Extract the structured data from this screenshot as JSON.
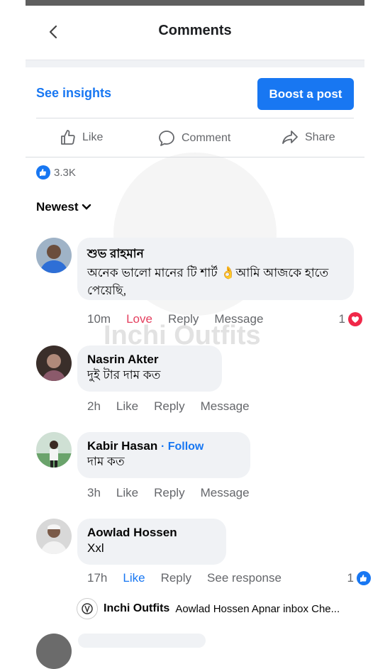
{
  "header": {
    "title": "Comments"
  },
  "post_actions": {
    "see_insights": "See insights",
    "boost": "Boost a post",
    "like": "Like",
    "comment": "Comment",
    "share": "Share"
  },
  "reactions": {
    "count": "3.3K"
  },
  "sort": {
    "label": "Newest"
  },
  "watermark": "Inchi Outfits",
  "comments": [
    {
      "author": "শুভ রাহমান",
      "text": "অনেক ভালো মানের টি শার্ট 👌আমি আজকে হাতে পেয়েছি,",
      "time": "10m",
      "reaction_label": "Love",
      "reply": "Reply",
      "message": "Message",
      "reaction_count": "1"
    },
    {
      "author": "Nasrin Akter",
      "text": "দুই টার দাম কত",
      "time": "2h",
      "like": "Like",
      "reply": "Reply",
      "message": "Message"
    },
    {
      "author": "Kabir Hasan",
      "follow": "Follow",
      "text": "দাম কত",
      "time": "3h",
      "like": "Like",
      "reply": "Reply",
      "message": "Message"
    },
    {
      "author": "Aowlad Hossen",
      "text": "Xxl",
      "time": "17h",
      "like": "Like",
      "reply": "Reply",
      "see_response": "See response",
      "reaction_count": "1",
      "page_reply": {
        "page": "Inchi Outfits",
        "preview": "Aowlad Hossen Apnar inbox Che..."
      }
    }
  ],
  "colors": {
    "accent": "#1877f2",
    "love": "#e4405f",
    "muted": "#65676b",
    "bubble": "#f0f2f5"
  }
}
